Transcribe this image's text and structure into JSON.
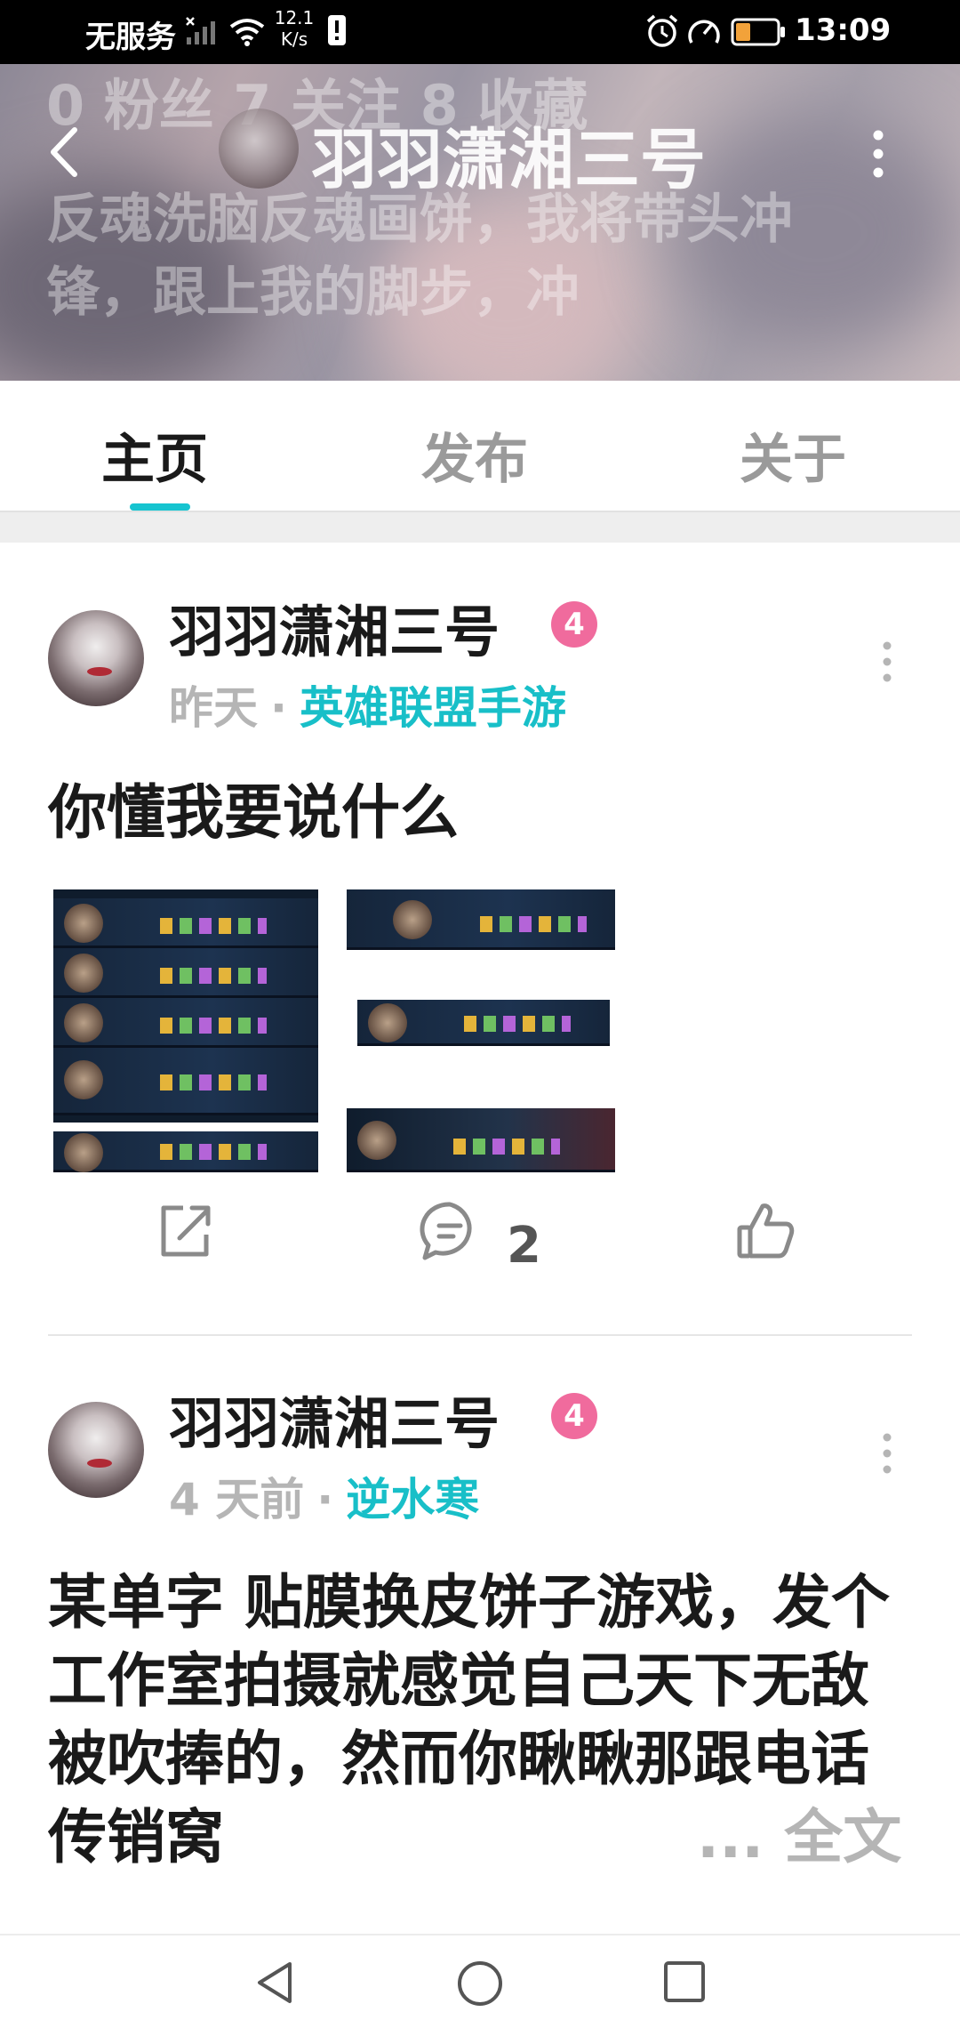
{
  "status_bar": {
    "carrier": "无服务",
    "net_speed_value": "12.1",
    "net_speed_unit": "K/s",
    "time": "13:09"
  },
  "header": {
    "title": "羽羽潇湘三号",
    "stats_text": "0 粉丝  7 关注  8 收藏",
    "bio_line1": "反魂洗脑反魂画饼，我将带头冲",
    "bio_line2": "锋，跟上我的脚步，冲"
  },
  "tabs": [
    {
      "label": "主页",
      "active": true
    },
    {
      "label": "发布",
      "active": false
    },
    {
      "label": "关于",
      "active": false
    }
  ],
  "posts": [
    {
      "author": "羽羽潇湘三号",
      "level": "4",
      "time": "昨天",
      "separator": "·",
      "game": "英雄联盟手游",
      "body": "你懂我要说什么",
      "comment_count": "2"
    },
    {
      "author": "羽羽潇湘三号",
      "level": "4",
      "time": "4 天前",
      "separator": "·",
      "game": "逆水寒",
      "body": "某单字 贴膜换皮饼子游戏，发个工作室拍摄就感觉自己天下无敌被吹捧的，然而你瞅瞅那跟电话传销窝",
      "ellipsis": "...",
      "more_label": "全文"
    }
  ],
  "colors": {
    "accent": "#16c4d0",
    "level_badge": "#f06b9d"
  },
  "icons": [
    "back-icon",
    "more-vertical-icon",
    "share-icon",
    "comment-icon",
    "like-icon",
    "nav-back-icon",
    "nav-home-icon",
    "nav-recents-icon"
  ]
}
